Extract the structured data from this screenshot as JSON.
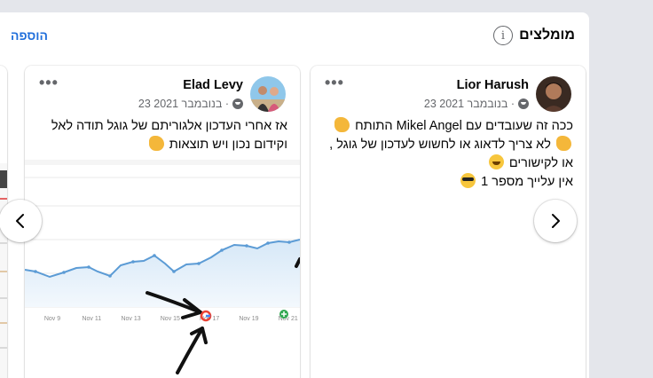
{
  "header": {
    "title": "מומלצים",
    "info_icon": "info-icon",
    "add_label": "הוספה"
  },
  "cards": [
    {
      "author": "Lior Harush",
      "date": "23 בנובמבר 2021 ·",
      "avatar_icon": "profile-avatar",
      "lines": [
        "ככה זה שעובדים עם Mikel Angel התותח",
        "לא צריך לדאוג או לחשוש לעדכון של גוגל ,",
        "או לקישורים",
        "אין עלייך מספר 1"
      ]
    },
    {
      "author": "Elad Levy",
      "date": "23 בנובמבר 2021 ·",
      "avatar_icon": "profile-avatar",
      "lines": [
        "אז אחרי העדכון אלגוריתם של גוגל תודה לאל",
        "וקידום נכון ויש תוצאות"
      ],
      "chart_data": {
        "type": "line",
        "x_labels": [
          "Nov 9",
          "Nov 11",
          "Nov 13",
          "Nov 15",
          "Nov 17",
          "Nov 19",
          "Nov 21"
        ]
      }
    }
  ],
  "nav": {
    "prev_icon": "chevron-left-icon",
    "next_icon": "chevron-right-icon"
  },
  "colors": {
    "accent": "#216fdb",
    "secondary_text": "#65676b",
    "chart_line": "#5b9bd5"
  }
}
